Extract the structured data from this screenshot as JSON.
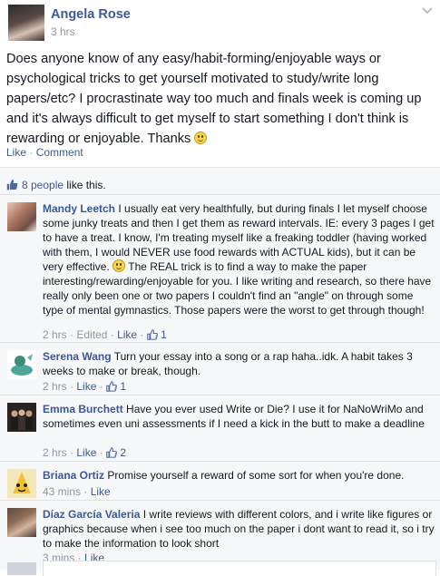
{
  "post": {
    "author": "Angela Rose",
    "time": "3 hrs",
    "text": "Does anyone know of any easy/habit-forming/enjoyable ways or psychological tricks to get yourself motivated to study/write long papers/etc? I procrastinate way too much and finals week is coming up and it's always difficult to get myself to start something I don't think is rewarding or enjoyable. Thanks",
    "like_label": "Like",
    "comment_label": "Comment",
    "separator": "·"
  },
  "likes": {
    "count_text": "8 people",
    "suffix": " like this."
  },
  "comments": [
    {
      "name": "Mandy Leetch",
      "text_before": "I usually eat very healthfully, but during finals I let myself choose some junky treats and then I get them as reward intervals. IE: every 3 pages I get to have a treat. I know, I'm treating myself like a freaking toddler (having worked with them, I would NEVER use food rewards with ACTUAL kids), but it can be very effective.",
      "text_after": "The REAL trick is to find a way to make the paper interesting/rewarding/enjoyable for you. I like writing and research, so there have really only been one or two papers I couldn't find an \"angle\" on through some type of mental gymnastics. Those papers were the worst to get through though!",
      "time": "2 hrs",
      "edited": "Edited",
      "like": "Like",
      "likes": "1"
    },
    {
      "name": "Serena Wang",
      "text": "Turn your essay into a song or a rap haha..idk. A habit takes 3 weeks to make or break, though.",
      "time": "2 hrs",
      "like": "Like",
      "likes": "1"
    },
    {
      "name": "Emma Burchett",
      "text": "Have you ever used Write or Die? I use it for NaNoWriMo and sometimes even uni assessments if I need a kick in the butt to make a deadline",
      "time": "2 hrs",
      "like": "Like",
      "likes": "2"
    },
    {
      "name": "Briana Ortiz",
      "text": "Promise yourself a reward of some sort for when you're done.",
      "time": "43 mins",
      "like": "Like"
    },
    {
      "name": "Díaz García Valeria",
      "text": "I write reviews with different colors, and i write like figures or graphics because when i see too much on the paper i dont want to read it, so i try to make the information to look short",
      "time": "3 mins",
      "like": "Like"
    }
  ],
  "colors": {
    "link": "#3b5998",
    "meta": "#9197a3",
    "background": "#f6f7f9"
  }
}
